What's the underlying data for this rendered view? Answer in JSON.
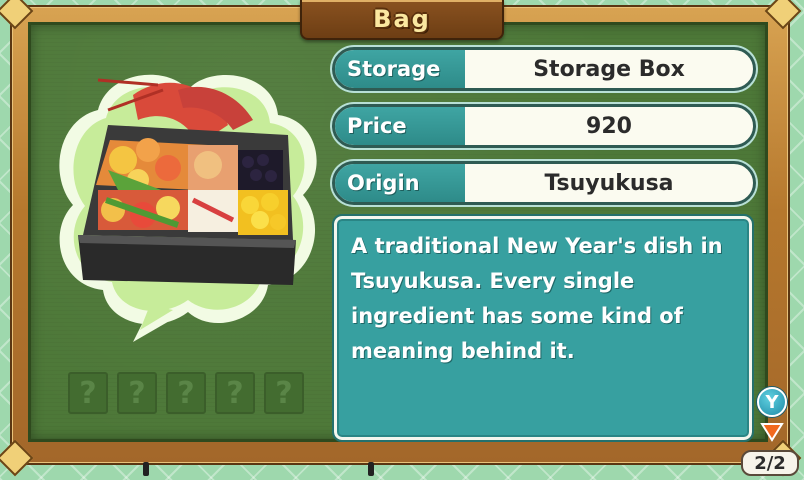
{
  "title": "Bag",
  "item": {
    "name": "Storage Box",
    "image_icon": "osechi-bento-box-icon"
  },
  "fields": {
    "storage": {
      "label": "Storage",
      "value": "Storage Box"
    },
    "price": {
      "label": "Price",
      "value": "920"
    },
    "origin": {
      "label": "Origin",
      "value": "Tsuyukusa"
    }
  },
  "description": [
    "A traditional New Year's dish in",
    "Tsuyukusa. Every single",
    "ingredient has some kind of",
    "meaning behind it."
  ],
  "mystery_slots": [
    "?",
    "?",
    "?",
    "?",
    "?"
  ],
  "controls": {
    "y_button": "Y",
    "page": "2/2"
  },
  "colors": {
    "board": "#4d7838",
    "teal": "#37a0a0",
    "label_teal": "#3fa5a3",
    "frame": "#b6782d",
    "plaque_text": "#fbe8a0",
    "bubble": "#c7ec9a"
  }
}
